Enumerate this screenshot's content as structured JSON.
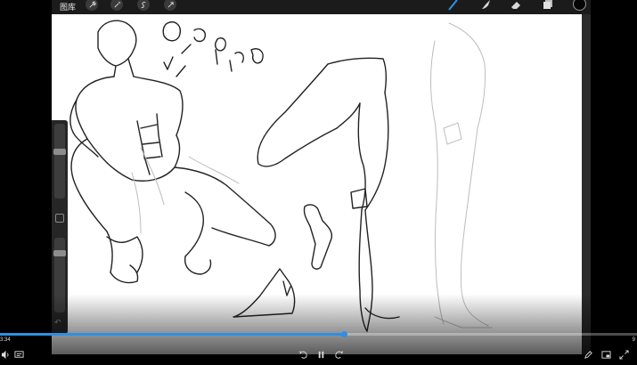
{
  "app": {
    "gallery_label": "图库",
    "toolbar_icons": [
      "wrench-icon",
      "magic-wand-icon",
      "selection-icon",
      "transform-arrow-icon"
    ],
    "tool_icons": [
      "brush-icon",
      "smudge-icon",
      "eraser-icon",
      "layers-icon"
    ],
    "current_color": "#050505"
  },
  "sidebar": {
    "brush_size_level": 0.85,
    "opacity_level": 0.75
  },
  "video": {
    "current_time": "3:34",
    "end_time": "9",
    "progress": 0.54,
    "accent_color": "#2f8fe6"
  }
}
